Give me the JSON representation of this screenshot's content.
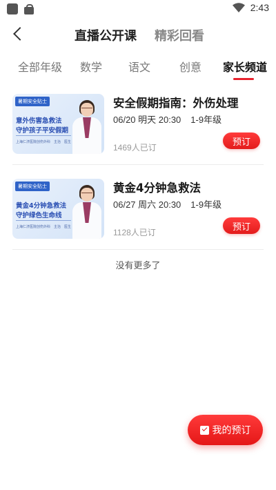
{
  "status_bar": {
    "time": "2:43"
  },
  "header": {
    "tabs": [
      {
        "label": "直播公开课",
        "active": true
      },
      {
        "label": "精彩回看",
        "active": false
      }
    ]
  },
  "categories": [
    {
      "label": "全部年级",
      "active": false
    },
    {
      "label": "数学",
      "active": false
    },
    {
      "label": "语文",
      "active": false
    },
    {
      "label": "创意",
      "active": false
    },
    {
      "label": "家长频道",
      "active": true
    }
  ],
  "courses": [
    {
      "title": "安全假期指南：外伤处理",
      "date": "06/20 明天 20:30",
      "grade": "1-9年级",
      "count": "1469人已订",
      "button": "预订",
      "thumb": {
        "badge": "暑期安全贴士",
        "line1": "意外伤害急救法",
        "line2": "守护孩子平安假期",
        "foot": "上海仁济医院创伤外科　主治　医生"
      }
    },
    {
      "title": "黄金4分钟急救法",
      "date": "06/27 周六 20:30",
      "grade": "1-9年级",
      "count": "1128人已订",
      "button": "预订",
      "thumb": {
        "badge": "暑期安全贴士",
        "line1": "黄金4分钟急救法",
        "line2": "守护绿色生命线",
        "foot": "上海仁济医院创伤外科　主治　医生"
      }
    }
  ],
  "footer": {
    "no_more": "没有更多了"
  },
  "fab": {
    "label": "我的预订",
    "icon": "calendar-check-icon"
  },
  "colors": {
    "accent": "#e8232e",
    "thumb_blue": "#2a4fb3"
  }
}
